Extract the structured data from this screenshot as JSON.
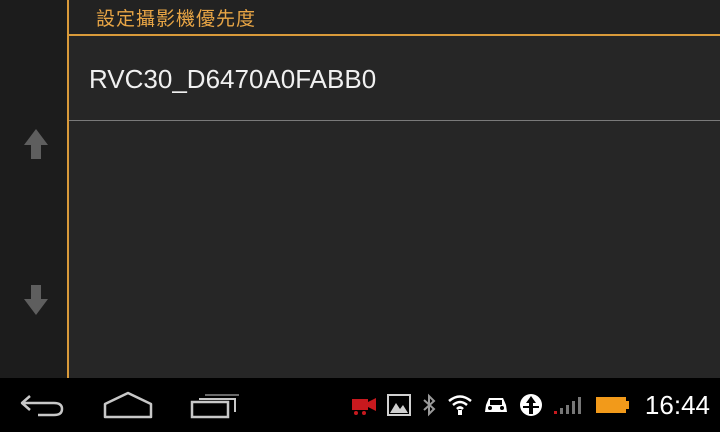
{
  "header": {
    "title": "設定攝影機優先度"
  },
  "list": {
    "items": [
      {
        "label": "RVC30_D6470A0FABB0"
      }
    ]
  },
  "rail": {
    "up_icon": "arrow-up-icon",
    "down_icon": "arrow-down-icon"
  },
  "navbar": {
    "buttons": [
      "back-icon",
      "home-icon",
      "recent-apps-icon"
    ]
  },
  "statusbar": {
    "icons": [
      "camera-record-icon",
      "gallery-icon",
      "bluetooth-icon",
      "wifi-icon",
      "car-icon",
      "navigation-icon",
      "signal-icon",
      "battery-icon"
    ],
    "time": "16:44",
    "battery_color": "#f29a1a",
    "record_color": "#c8191e"
  },
  "colors": {
    "accent": "#d99a3a",
    "background": "#262626",
    "title": "#e8a545"
  }
}
